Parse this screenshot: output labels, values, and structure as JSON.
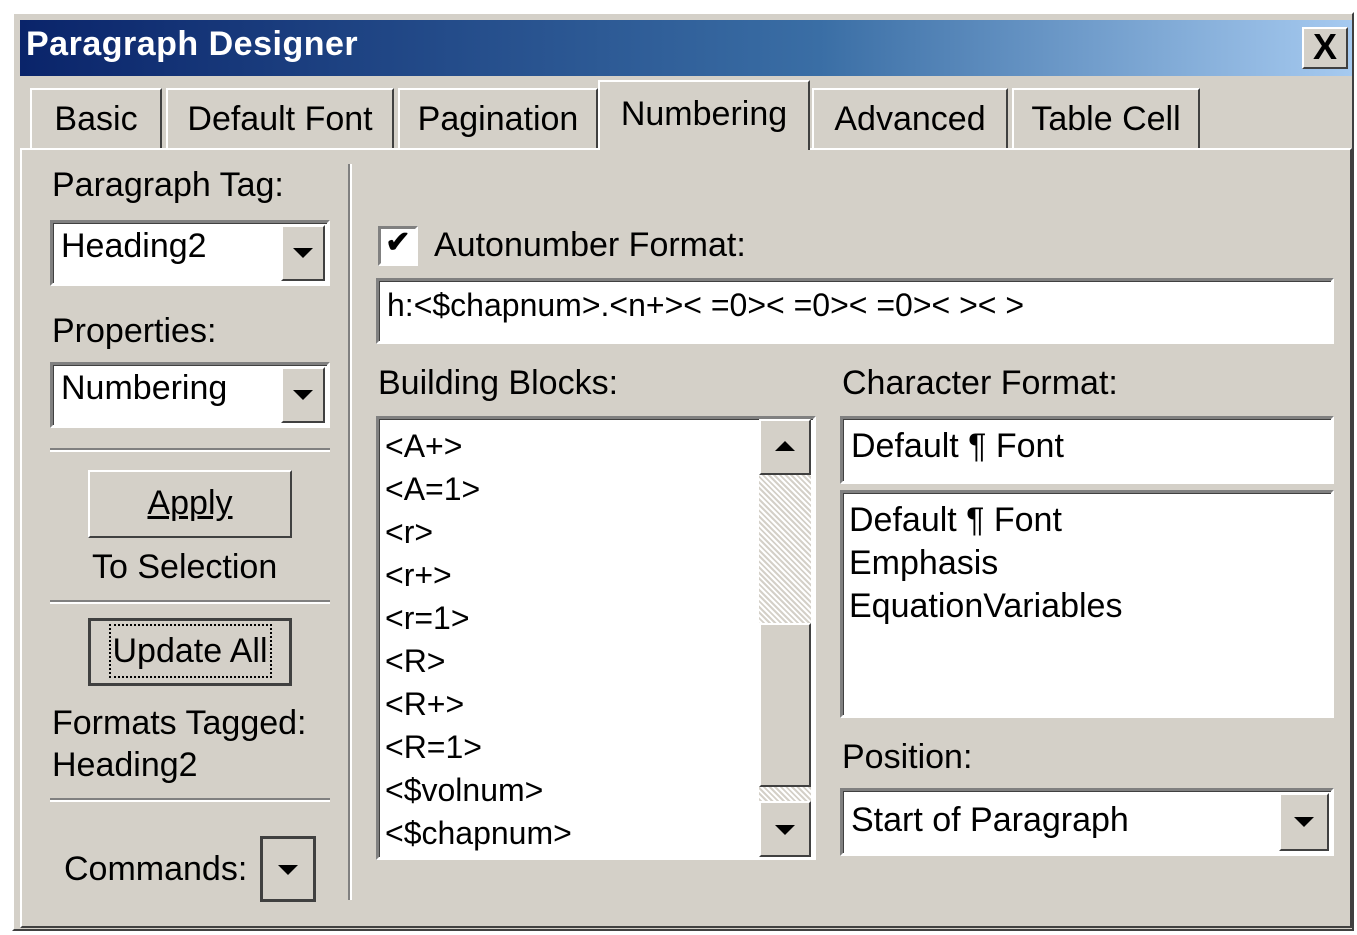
{
  "window": {
    "title": "Paragraph Designer",
    "close_label": "X"
  },
  "tabs": [
    {
      "label": "Basic"
    },
    {
      "label": "Default Font"
    },
    {
      "label": "Pagination"
    },
    {
      "label": "Numbering",
      "active": true
    },
    {
      "label": "Advanced"
    },
    {
      "label": "Table Cell"
    }
  ],
  "left": {
    "paragraph_tag_label": "Paragraph Tag:",
    "paragraph_tag_value": "Heading2",
    "properties_label": "Properties:",
    "properties_value": "Numbering",
    "apply_label": "Apply",
    "to_selection_label": "To Selection",
    "update_all_label": "Update All",
    "formats_tagged_label": "Formats Tagged:",
    "formats_tagged_value": "Heading2",
    "commands_label": "Commands:"
  },
  "numbering": {
    "autonumber_checked": true,
    "autonumber_label": "Autonumber Format:",
    "autonumber_value": "h:<$chapnum>.<n+>< =0>< =0>< =0>< >< >",
    "building_blocks_label": "Building Blocks:",
    "building_blocks": [
      "<A+>",
      "<A=1>",
      "<r>",
      "<r+>",
      "<r=1>",
      "<R>",
      "<R+>",
      "<R=1>",
      "<$volnum>",
      "<$chapnum>"
    ],
    "character_format_label": "Character Format:",
    "character_format_value": "Default ¶ Font",
    "character_formats": [
      "Default ¶ Font",
      "Emphasis",
      "EquationVariables"
    ],
    "position_label": "Position:",
    "position_value": "Start of Paragraph"
  }
}
